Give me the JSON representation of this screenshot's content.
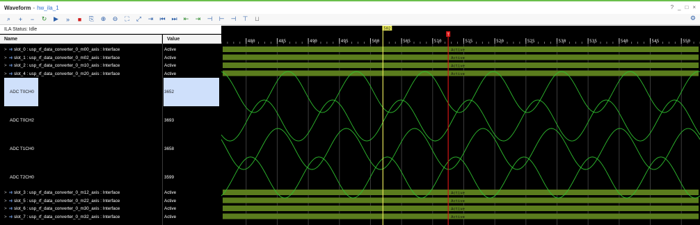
{
  "title": {
    "window": "Waveform",
    "separator": "-",
    "subtitle": "hw_ila_1",
    "controls": [
      "?",
      "_",
      "□",
      "×"
    ]
  },
  "toolbar": {
    "buttons": [
      {
        "icon": "search-icon",
        "glyph": "⌕",
        "color": "#2d5fa8"
      },
      {
        "icon": "plus-icon",
        "glyph": "+",
        "color": "#2d5fa8"
      },
      {
        "icon": "minus-icon",
        "glyph": "−",
        "color": "#2d5fa8"
      },
      {
        "icon": "refresh-icon",
        "glyph": "↻",
        "color": "#2e8b2e"
      },
      {
        "icon": "run-trigger-icon",
        "glyph": "▶",
        "color": "#2d5fa8"
      },
      {
        "icon": "run-immediate-icon",
        "glyph": "»",
        "color": "#2d5fa8"
      },
      {
        "icon": "stop-icon",
        "glyph": "■",
        "color": "#d11b1b"
      },
      {
        "icon": "export-icon",
        "glyph": "⎘",
        "color": "#2d5fa8"
      },
      {
        "icon": "zoom-in-icon",
        "glyph": "⊕",
        "color": "#2d5fa8"
      },
      {
        "icon": "zoom-out-icon",
        "glyph": "⊖",
        "color": "#2d5fa8"
      },
      {
        "icon": "zoom-fit-icon",
        "glyph": "⛶",
        "color": "#2d5fa8"
      },
      {
        "icon": "zoom-cursor-icon",
        "glyph": "⤢",
        "color": "#2d5fa8"
      },
      {
        "icon": "cursor-icon",
        "glyph": "⇥",
        "color": "#2d5fa8"
      },
      {
        "icon": "go-first-icon",
        "glyph": "⏮",
        "color": "#2d5fa8"
      },
      {
        "icon": "go-last-icon",
        "glyph": "⏭",
        "color": "#2d5fa8"
      },
      {
        "icon": "prev-transition-icon",
        "glyph": "⇤",
        "color": "#2e8b2e"
      },
      {
        "icon": "next-transition-icon",
        "glyph": "⇥",
        "color": "#2e8b2e"
      },
      {
        "icon": "add-marker-icon",
        "glyph": "⊣",
        "color": "#2d5fa8"
      },
      {
        "icon": "prev-marker-icon",
        "glyph": "⊢",
        "color": "#2d5fa8"
      },
      {
        "icon": "next-marker-icon",
        "glyph": "⊣",
        "color": "#2d5fa8"
      },
      {
        "icon": "swap-cursor-icon",
        "glyph": "⊤",
        "color": "#2d5fa8"
      },
      {
        "icon": "snap-icon",
        "glyph": "⊔",
        "color": "#8a8a8a"
      }
    ],
    "settings_icon": "gear-icon"
  },
  "panel": {
    "status": "ILA Status: Idle",
    "col_name": "Name",
    "col_value": "Value"
  },
  "signals": [
    {
      "name": "slot_0 : usp_rf_data_converter_0_m00_axis : Interface",
      "value": "Active",
      "kind": "bus"
    },
    {
      "name": "slot_1 : usp_rf_data_converter_0_m02_axis : Interface",
      "value": "Active",
      "kind": "bus"
    },
    {
      "name": "slot_2 : usp_rf_data_converter_0_m10_axis : Interface",
      "value": "Active",
      "kind": "bus"
    },
    {
      "name": "slot_4 : usp_rf_data_converter_0_m20_axis : Interface",
      "value": "Active",
      "kind": "bus"
    },
    {
      "name": "ADC T0CH0",
      "value": "3652",
      "kind": "analog",
      "selected": true
    },
    {
      "name": "ADC T0CH2",
      "value": "3693",
      "kind": "analog"
    },
    {
      "name": "ADC T1CH0",
      "value": "3658",
      "kind": "analog"
    },
    {
      "name": "ADC T2CH0",
      "value": "3599",
      "kind": "analog"
    },
    {
      "name": "slot_3 : usp_rf_data_converter_0_m12_axis : Interface",
      "value": "Active",
      "kind": "bus"
    },
    {
      "name": "slot_5 : usp_rf_data_converter_0_m22_axis : Interface",
      "value": "Active",
      "kind": "bus"
    },
    {
      "name": "slot_6 : usp_rf_data_converter_0_m30_axis : Interface",
      "value": "Active",
      "kind": "bus"
    },
    {
      "name": "slot_7 : usp_rf_data_converter_0_m32_axis : Interface",
      "value": "Active",
      "kind": "bus"
    }
  ],
  "waveform": {
    "ruler_ticks": [
      "480",
      "485",
      "490",
      "495",
      "500",
      "505",
      "510",
      "515",
      "520",
      "525",
      "530",
      "535",
      "540",
      "545",
      "550"
    ],
    "bus_label": "Active",
    "cursor_label": "502",
    "trigger_marker": "T",
    "colors": {
      "bus_fill": "#5b7d1d",
      "wave": "#2fbf2f",
      "cursor": "#e6e65a",
      "trigger": "#d41515",
      "grid": "#3c3c3c"
    },
    "time_range": [
      476,
      553
    ],
    "cursor_time": 502,
    "trigger_time": 512.5,
    "wave_period": 11
  }
}
